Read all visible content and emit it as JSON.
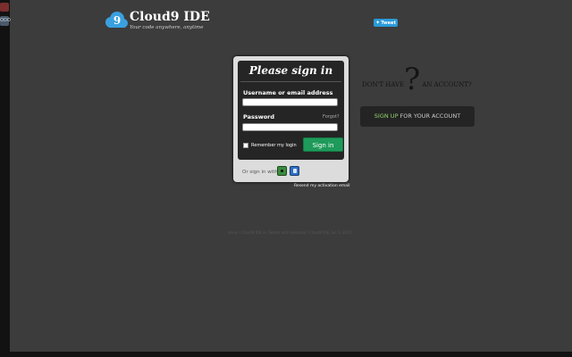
{
  "logo": {
    "title": "Cloud9 IDE",
    "tagline": "Your code anywhere, anytime",
    "cloud_number": "9",
    "cloud_color": "#3aa0e0"
  },
  "tweet": {
    "label": "Tweet",
    "icon": "bird-icon",
    "color": "#2b9ad8"
  },
  "strip": {
    "mid_label": "OOO"
  },
  "signin": {
    "title": "Please sign in",
    "username_label": "Username or email address",
    "username_value": "",
    "password_label": "Password",
    "password_value": "",
    "forgot": "Forgot?",
    "remember": "Remember my login",
    "remember_checked": false,
    "button": "Sign in",
    "button_color": "#1e9a5a",
    "or_sign_in": "Or sign in with:",
    "providers": [
      "github-icon",
      "bitbucket-icon"
    ]
  },
  "resend": "Resend my activation email",
  "account": {
    "dont_have_pre": "DON'T HAVE",
    "dont_have_post": "AN ACCOUNT?",
    "qmark": "?",
    "signup_emph": "SIGN UP",
    "signup_rest": " FOR YOUR ACCOUNT",
    "signup_color": "#8fd46a"
  },
  "footer": "Home  |  Cloud9 IDE on Twitter and Facebook  |  Cloud9 IDE, Inc © 2011"
}
